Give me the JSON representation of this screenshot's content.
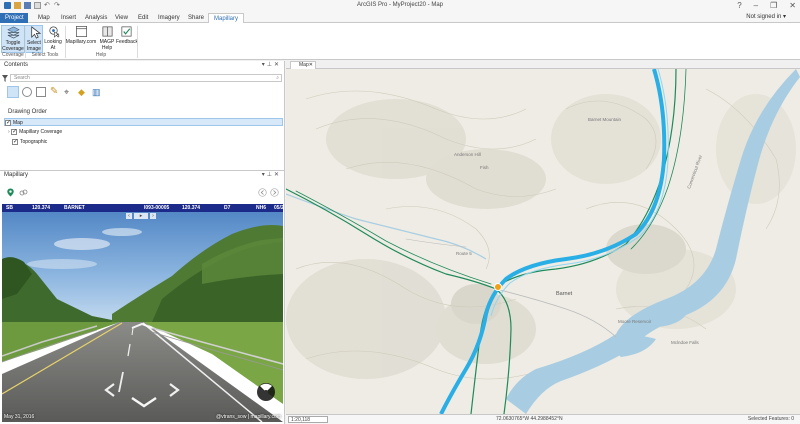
{
  "window": {
    "title": "ArcGIS Pro - MyProject20 - Map",
    "controls": [
      "?",
      "–",
      "❐",
      "✕"
    ]
  },
  "tabs": [
    {
      "label": "Project"
    },
    {
      "label": "Map"
    },
    {
      "label": "Insert"
    },
    {
      "label": "Analysis"
    },
    {
      "label": "View"
    },
    {
      "label": "Edit"
    },
    {
      "label": "Imagery"
    },
    {
      "label": "Share"
    },
    {
      "label": "Mapillary"
    }
  ],
  "user": {
    "status": "Not signed in ▾"
  },
  "ribbon": {
    "buttons": {
      "toggle_coverage": "Toggle Coverage",
      "select_image": "Select Image",
      "looking_at": "Looking At",
      "mapillary_com": "Mapillary.com",
      "magp_help": "MAGP Help",
      "feedback": "Feedback"
    },
    "groups": {
      "coverage": "Coverage",
      "select_tools": "Select Tools",
      "help": "Help"
    }
  },
  "contents": {
    "title": "Contents",
    "search_placeholder": "Search",
    "drawing_order": "Drawing Order",
    "layers": [
      {
        "label": "Map"
      },
      {
        "label": "Mapillary Coverage"
      },
      {
        "label": "Topographic"
      }
    ]
  },
  "mapillary_pane": {
    "title": "Mapillary",
    "image_bar": {
      "sb": "SB",
      "mile1": "120.374",
      "town": "BARNET",
      "id": "I093-00005",
      "mile2": "120.374",
      "code": "D7",
      "dir": "NH6",
      "tail": "05/2"
    },
    "date": "May 31, 2016",
    "credit": "@vtrans_sow | mapillary.com"
  },
  "map": {
    "tab_label": "Map",
    "labels": {
      "barnet_mountain": "Barnet Mountain",
      "anderson_hill": "Anderson Hill",
      "barnet": "Barnet",
      "moore_res": "Moore Reservoir",
      "connecticut": "Connecticut River",
      "route": "Route 5",
      "topo1": "Fish",
      "topo2": "Mclndoe Falls"
    },
    "status": {
      "scale": "1:20,118",
      "coords": "72.0630765°W 44.2988452°N",
      "selected": "Selected Features: 0"
    }
  },
  "colors": {
    "accent": "#2f6fb5",
    "coverage_line": "#29aee6",
    "roads": "#1e8a5a",
    "water": "#9ec6de"
  }
}
